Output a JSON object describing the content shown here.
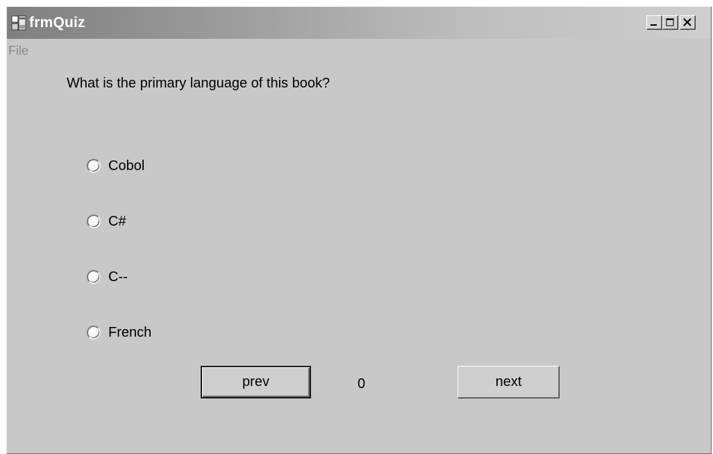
{
  "window": {
    "title": "frmQuiz",
    "controls": {
      "minimize": "minimize-icon",
      "maximize": "maximize-icon",
      "close": "close-icon"
    }
  },
  "menu": {
    "file_label": "File"
  },
  "quiz": {
    "question": "What is the primary language of this book?",
    "options": [
      {
        "label": "Cobol",
        "selected": false
      },
      {
        "label": "C#",
        "selected": false
      },
      {
        "label": "C--",
        "selected": false
      },
      {
        "label": "French",
        "selected": false
      }
    ],
    "prev_label": "prev",
    "next_label": "next",
    "counter": "0"
  },
  "colors": {
    "window_bg": "#c8c8c8",
    "title_text": "#ffffff",
    "menu_text_disabled": "#8a8a8a"
  }
}
